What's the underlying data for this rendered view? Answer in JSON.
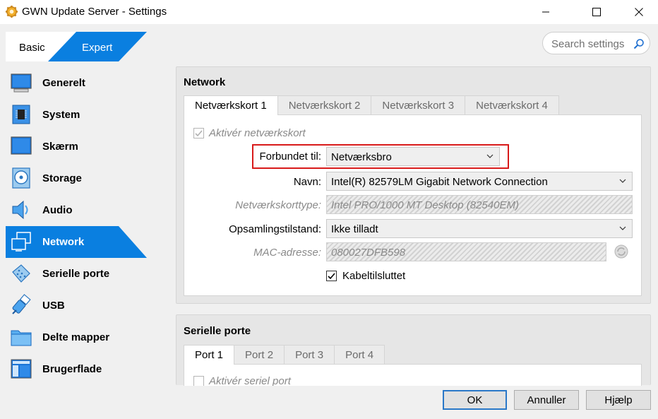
{
  "window": {
    "title": "GWN Update Server - Settings",
    "icon": "gear-app-icon",
    "controls": [
      "minimize-icon",
      "maximize-icon",
      "close-icon"
    ]
  },
  "mode": {
    "basic_label": "Basic",
    "expert_label": "Expert",
    "selected": "Expert",
    "accent": "#0a7fe0"
  },
  "search": {
    "placeholder": "Search settings"
  },
  "sidebar": {
    "items": [
      {
        "label": "Generelt",
        "icon": "monitor-general-icon"
      },
      {
        "label": "System",
        "icon": "chip-icon"
      },
      {
        "label": "Skærm",
        "icon": "display-icon"
      },
      {
        "label": "Storage",
        "icon": "disk-icon"
      },
      {
        "label": "Audio",
        "icon": "speaker-icon"
      },
      {
        "label": "Network",
        "icon": "network-icon"
      },
      {
        "label": "Serielle porte",
        "icon": "serial-port-icon"
      },
      {
        "label": "USB",
        "icon": "usb-icon"
      },
      {
        "label": "Delte mapper",
        "icon": "folder-icon"
      },
      {
        "label": "Brugerflade",
        "icon": "user-interface-icon"
      }
    ],
    "selected": "Network"
  },
  "network": {
    "title": "Network",
    "tabs": [
      "Netværkskort 1",
      "Netværkskort 2",
      "Netværkskort 3",
      "Netværkskort 4"
    ],
    "active_tab": "Netværkskort 1",
    "enable_label": "Aktivér netværkskort",
    "enable_checked": true,
    "attached_label": "Forbundet til:",
    "attached_value": "Netværksbro",
    "name_label": "Navn:",
    "name_value": "Intel(R) 82579LM Gigabit Network Connection",
    "adapter_type_label": "Netværkskorttype:",
    "adapter_type_value": "Intel PRO/1000 MT Desktop (82540EM)",
    "promisc_label": "Opsamlingstilstand:",
    "promisc_value": "Ikke tilladt",
    "mac_label": "MAC-adresse:",
    "mac_value": "080027DFB598",
    "cable_label": "Kabeltilsluttet",
    "cable_checked": true
  },
  "serial": {
    "title": "Serielle porte",
    "tabs": [
      "Port 1",
      "Port 2",
      "Port 3",
      "Port 4"
    ],
    "active_tab": "Port 1",
    "enable_label": "Aktivér seriel port",
    "enable_checked": false
  },
  "buttons": {
    "ok": "OK",
    "cancel": "Annuller",
    "help": "Hjælp"
  }
}
